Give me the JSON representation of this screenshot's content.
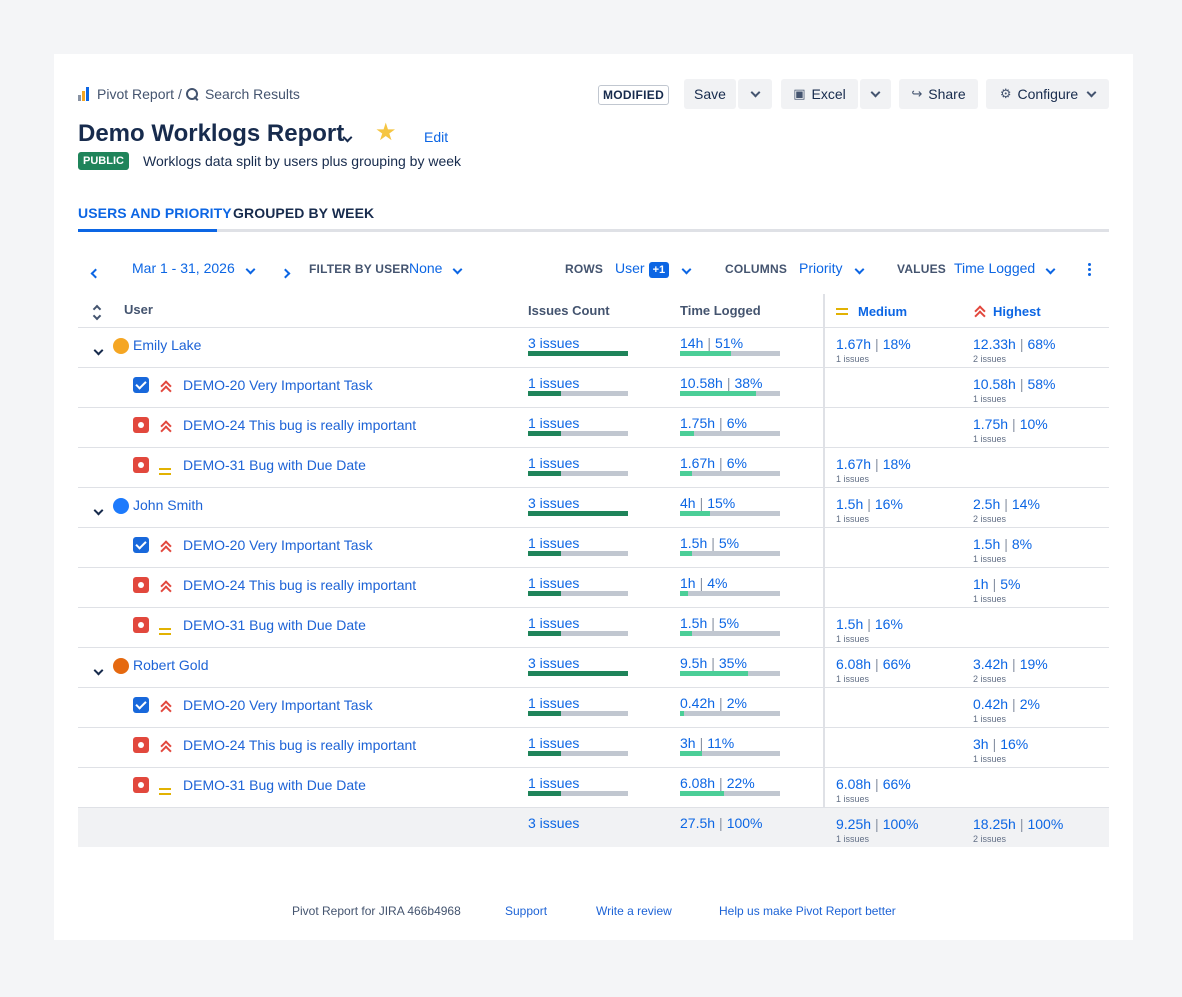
{
  "breadcrumb": {
    "app": "Pivot Report",
    "separator": "/",
    "page": "Search Results"
  },
  "toolbar": {
    "modified": "MODIFIED",
    "save": "Save",
    "excel": "Excel",
    "share": "Share",
    "configure": "Configure"
  },
  "report": {
    "title": "Demo Worklogs Report",
    "edit": "Edit",
    "visibility": "PUBLIC",
    "description": "Worklogs data split by users plus grouping by week"
  },
  "tabs": [
    {
      "label": "USERS AND PRIORITY",
      "active": true
    },
    {
      "label": "GROUPED BY WEEK",
      "active": false
    }
  ],
  "filters": {
    "date_range": "Mar 1 - 31, 2026",
    "filter_by_user_label": "FILTER BY USER",
    "filter_by_user_value": "None",
    "rows_label": "ROWS",
    "rows_value": "User",
    "rows_extra": "+1",
    "columns_label": "COLUMNS",
    "columns_value": "Priority",
    "values_label": "VALUES",
    "values_value": "Time Logged"
  },
  "table": {
    "headers": {
      "user": "User",
      "issues_count": "Issues Count",
      "time_logged": "Time Logged",
      "medium": "Medium",
      "highest": "Highest"
    },
    "rows": [
      {
        "label": "Emily Lake",
        "count": "3 issues",
        "count_fill": 1.0,
        "time": "14h",
        "time_pct": "51%",
        "time_fill": 0.51,
        "med": "1.67h",
        "med_pct": "18%",
        "med_sub": "1 issues",
        "high": "12.33h",
        "high_pct": "68%",
        "high_sub": "2 issues"
      },
      {
        "label": "DEMO-20 Very Important Task",
        "count": "1 issues",
        "count_fill": 0.33,
        "time": "10.58h",
        "time_pct": "38%",
        "time_fill": 0.76,
        "med": "",
        "med_pct": "",
        "med_sub": "",
        "high": "10.58h",
        "high_pct": "58%",
        "high_sub": "1 issues"
      },
      {
        "label": "DEMO-24 This bug is really important",
        "count": "1 issues",
        "count_fill": 0.33,
        "time": "1.75h",
        "time_pct": "6%",
        "time_fill": 0.14,
        "med": "",
        "med_pct": "",
        "med_sub": "",
        "high": "1.75h",
        "high_pct": "10%",
        "high_sub": "1 issues"
      },
      {
        "label": "DEMO-31 Bug with Due Date",
        "count": "1 issues",
        "count_fill": 0.33,
        "time": "1.67h",
        "time_pct": "6%",
        "time_fill": 0.12,
        "med": "1.67h",
        "med_pct": "18%",
        "med_sub": "1 issues",
        "high": "",
        "high_pct": "",
        "high_sub": ""
      },
      {
        "label": "John Smith",
        "count": "3 issues",
        "count_fill": 1.0,
        "time": "4h",
        "time_pct": "15%",
        "time_fill": 0.3,
        "med": "1.5h",
        "med_pct": "16%",
        "med_sub": "1 issues",
        "high": "2.5h",
        "high_pct": "14%",
        "high_sub": "2 issues"
      },
      {
        "label": "DEMO-20 Very Important Task",
        "count": "1 issues",
        "count_fill": 0.33,
        "time": "1.5h",
        "time_pct": "5%",
        "time_fill": 0.12,
        "med": "",
        "med_pct": "",
        "med_sub": "",
        "high": "1.5h",
        "high_pct": "8%",
        "high_sub": "1 issues"
      },
      {
        "label": "DEMO-24 This bug is really important",
        "count": "1 issues",
        "count_fill": 0.33,
        "time": "1h",
        "time_pct": "4%",
        "time_fill": 0.08,
        "med": "",
        "med_pct": "",
        "med_sub": "",
        "high": "1h",
        "high_pct": "5%",
        "high_sub": "1 issues"
      },
      {
        "label": "DEMO-31 Bug with Due Date",
        "count": "1 issues",
        "count_fill": 0.33,
        "time": "1.5h",
        "time_pct": "5%",
        "time_fill": 0.12,
        "med": "1.5h",
        "med_pct": "16%",
        "med_sub": "1 issues",
        "high": "",
        "high_pct": "",
        "high_sub": ""
      },
      {
        "label": "Robert Gold",
        "count": "3 issues",
        "count_fill": 1.0,
        "time": "9.5h",
        "time_pct": "35%",
        "time_fill": 0.68,
        "med": "6.08h",
        "med_pct": "66%",
        "med_sub": "1 issues",
        "high": "3.42h",
        "high_pct": "19%",
        "high_sub": "2 issues"
      },
      {
        "label": "DEMO-20 Very Important Task",
        "count": "1 issues",
        "count_fill": 0.33,
        "time": "0.42h",
        "time_pct": "2%",
        "time_fill": 0.04,
        "med": "",
        "med_pct": "",
        "med_sub": "",
        "high": "0.42h",
        "high_pct": "2%",
        "high_sub": "1 issues"
      },
      {
        "label": "DEMO-24 This bug is really important",
        "count": "1 issues",
        "count_fill": 0.33,
        "time": "3h",
        "time_pct": "11%",
        "time_fill": 0.22,
        "med": "",
        "med_pct": "",
        "med_sub": "",
        "high": "3h",
        "high_pct": "16%",
        "high_sub": "1 issues"
      },
      {
        "label": "DEMO-31 Bug with Due Date",
        "count": "1 issues",
        "count_fill": 0.33,
        "time": "6.08h",
        "time_pct": "22%",
        "time_fill": 0.44,
        "med": "6.08h",
        "med_pct": "66%",
        "med_sub": "1 issues",
        "high": "",
        "high_pct": "",
        "high_sub": ""
      }
    ],
    "total": {
      "count": "3 issues",
      "time": "27.5h",
      "time_pct": "100%",
      "med": "9.25h",
      "med_pct": "100%",
      "med_sub": "1 issues",
      "high": "18.25h",
      "high_pct": "100%",
      "high_sub": "2 issues"
    }
  },
  "footer": {
    "app": "Pivot Report for JIRA 466b4968",
    "support": "Support",
    "review": "Write a review",
    "feedback": "Help us make Pivot Report better"
  },
  "colors": {
    "brand_blue": "#0c66e4",
    "count_bar": "#1f845a",
    "time_bar": "#4bce97",
    "bar_track": "#c1c7d0",
    "bug": "#e2483d",
    "task": "#1868db",
    "priority_medium": "#e2b203"
  },
  "icons": {
    "user_rows": [
      "chevron-down-icon",
      "avatar"
    ],
    "task": "checkbox-icon",
    "bug": "bug-icon",
    "highest": "priority-highest-icon",
    "medium": "priority-medium-icon"
  }
}
